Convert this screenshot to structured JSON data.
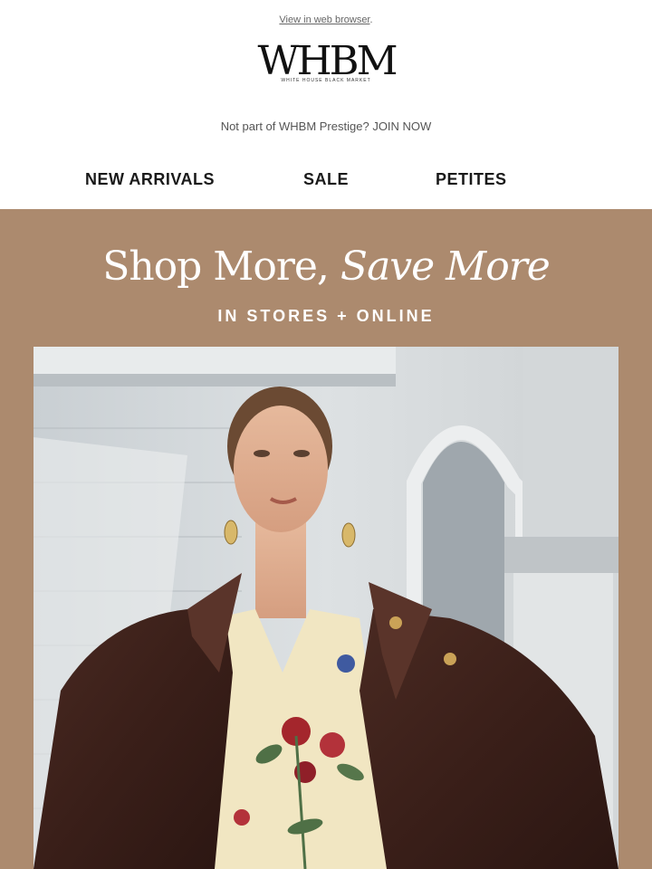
{
  "header": {
    "browser_link": "View in web browser",
    "browser_link_suffix": ".",
    "logo_text": "WHBM",
    "logo_subtext": "WHITE HOUSE BLACK MARKET",
    "prestige_text": "Not part of WHBM Prestige?",
    "prestige_join": "JOIN NOW"
  },
  "nav": {
    "items": [
      {
        "label": "NEW ARRIVALS"
      },
      {
        "label": "SALE"
      },
      {
        "label": "PETITES"
      }
    ]
  },
  "hero": {
    "title_regular": "Shop More,",
    "title_italic": "Save More",
    "subtitle": "IN STORES + ONLINE",
    "background_color": "#ac8a6e",
    "image_alt_icon": "model-photo"
  }
}
